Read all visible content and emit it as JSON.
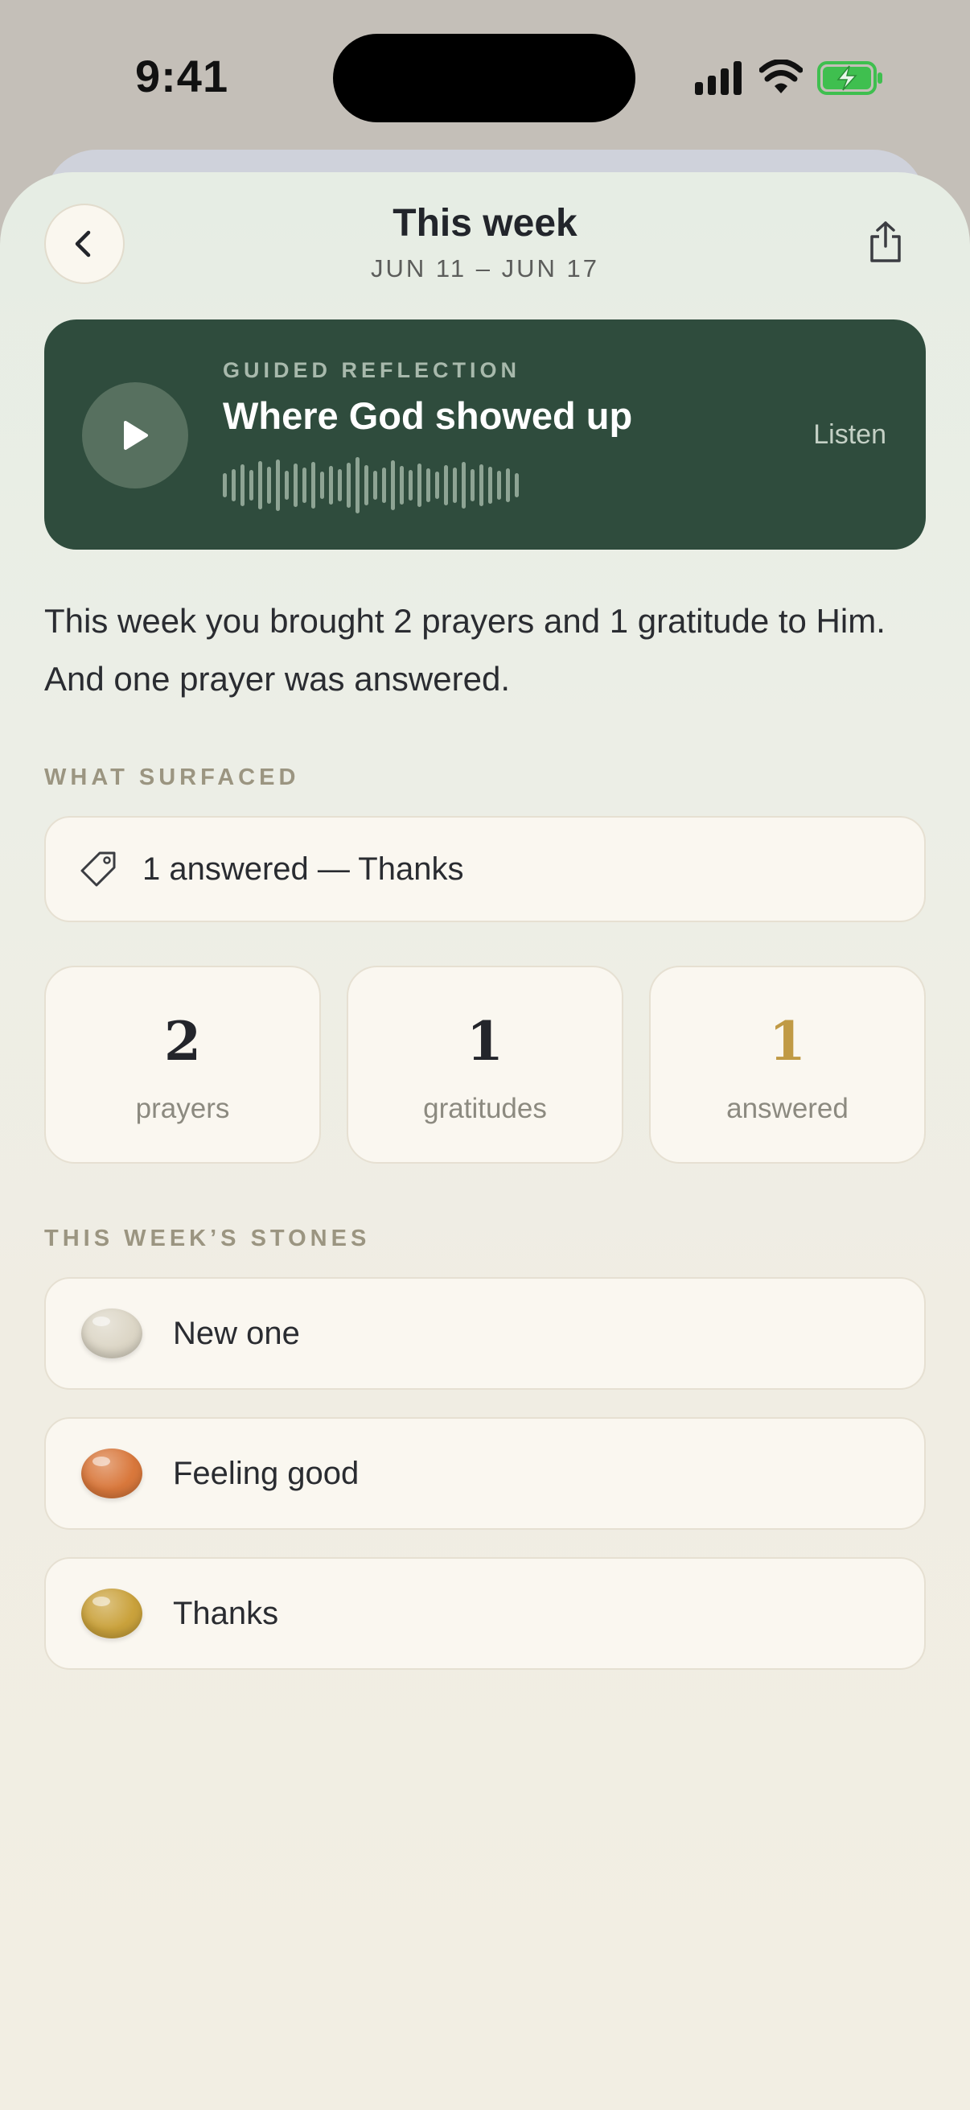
{
  "status_bar": {
    "time": "9:41",
    "battery_color": "#3fbf4f"
  },
  "header": {
    "title": "This week",
    "subtitle": "JUN 11 – JUN 17",
    "back_icon": "chevron-left-icon",
    "share_icon": "share-icon"
  },
  "reflection": {
    "kicker": "GUIDED REFLECTION",
    "title": "Where God showed up",
    "action_label": "Listen",
    "play_icon": "play-icon",
    "card_color": "#2f4c3d"
  },
  "summary": "This week you brought 2 prayers and 1 gratitude to Him. And one prayer was answered.",
  "surfaced": {
    "label": "WHAT SURFACED",
    "item_text": "1 answered — Thanks",
    "icon": "tag-icon"
  },
  "stats": [
    {
      "value": "2",
      "label": "prayers"
    },
    {
      "value": "1",
      "label": "gratitudes"
    },
    {
      "value": "1",
      "label": "answered",
      "accent": "#c09a45"
    }
  ],
  "stones": {
    "label": "THIS WEEK’S STONES",
    "items": [
      {
        "name": "New one",
        "color": "#dcd6c6"
      },
      {
        "name": "Feeling good",
        "color": "#d9783c"
      },
      {
        "name": "Thanks",
        "color": "#caa23c"
      }
    ]
  }
}
